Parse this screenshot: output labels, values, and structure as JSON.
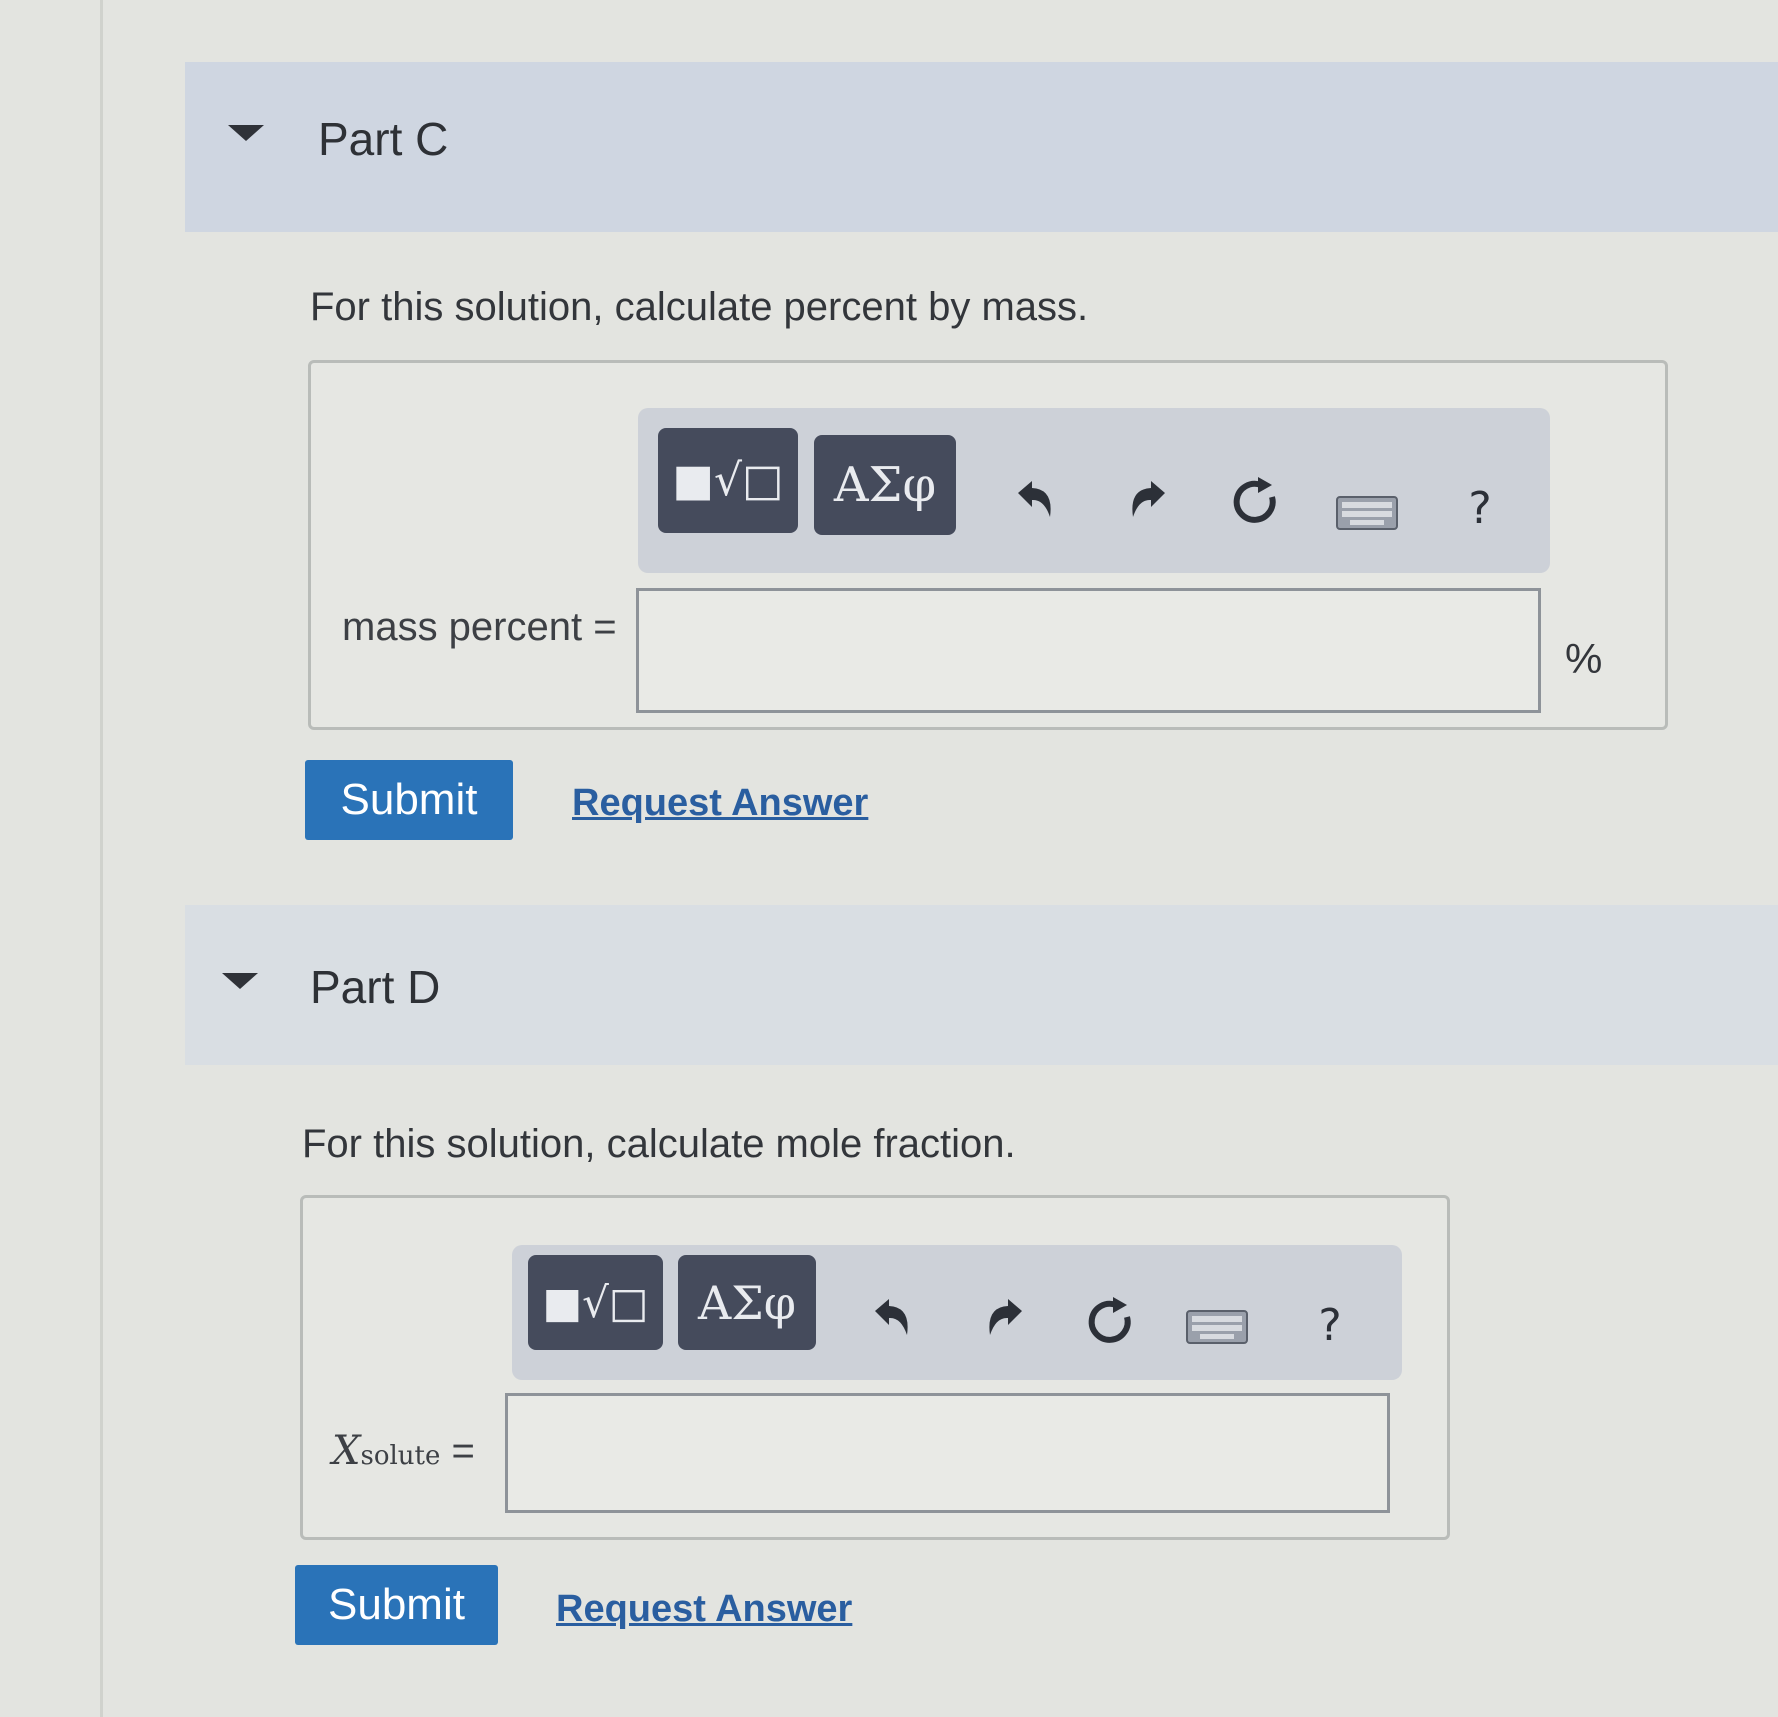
{
  "partC": {
    "title": "Part C",
    "prompt": "For this solution, calculate percent by mass.",
    "field_label": "mass percent =",
    "unit": "%",
    "toolbar": {
      "templates_label": "■√□",
      "symbols_label": "ΑΣφ",
      "icons": [
        "undo-icon",
        "redo-icon",
        "reset-icon",
        "keyboard-icon",
        "help-icon"
      ],
      "help_label": "?"
    },
    "submit_label": "Submit",
    "request_label": "Request Answer",
    "input_value": ""
  },
  "partD": {
    "title": "Part D",
    "prompt": "For this solution, calculate mole fraction.",
    "field_label_main": "X",
    "field_label_sub": "solute",
    "field_label_eq": "=",
    "toolbar": {
      "templates_label": "■√□",
      "symbols_label": "ΑΣφ",
      "icons": [
        "undo-icon",
        "redo-icon",
        "reset-icon",
        "keyboard-icon",
        "help-icon"
      ],
      "help_label": "?"
    },
    "submit_label": "Submit",
    "request_label": "Request Answer",
    "input_value": ""
  }
}
